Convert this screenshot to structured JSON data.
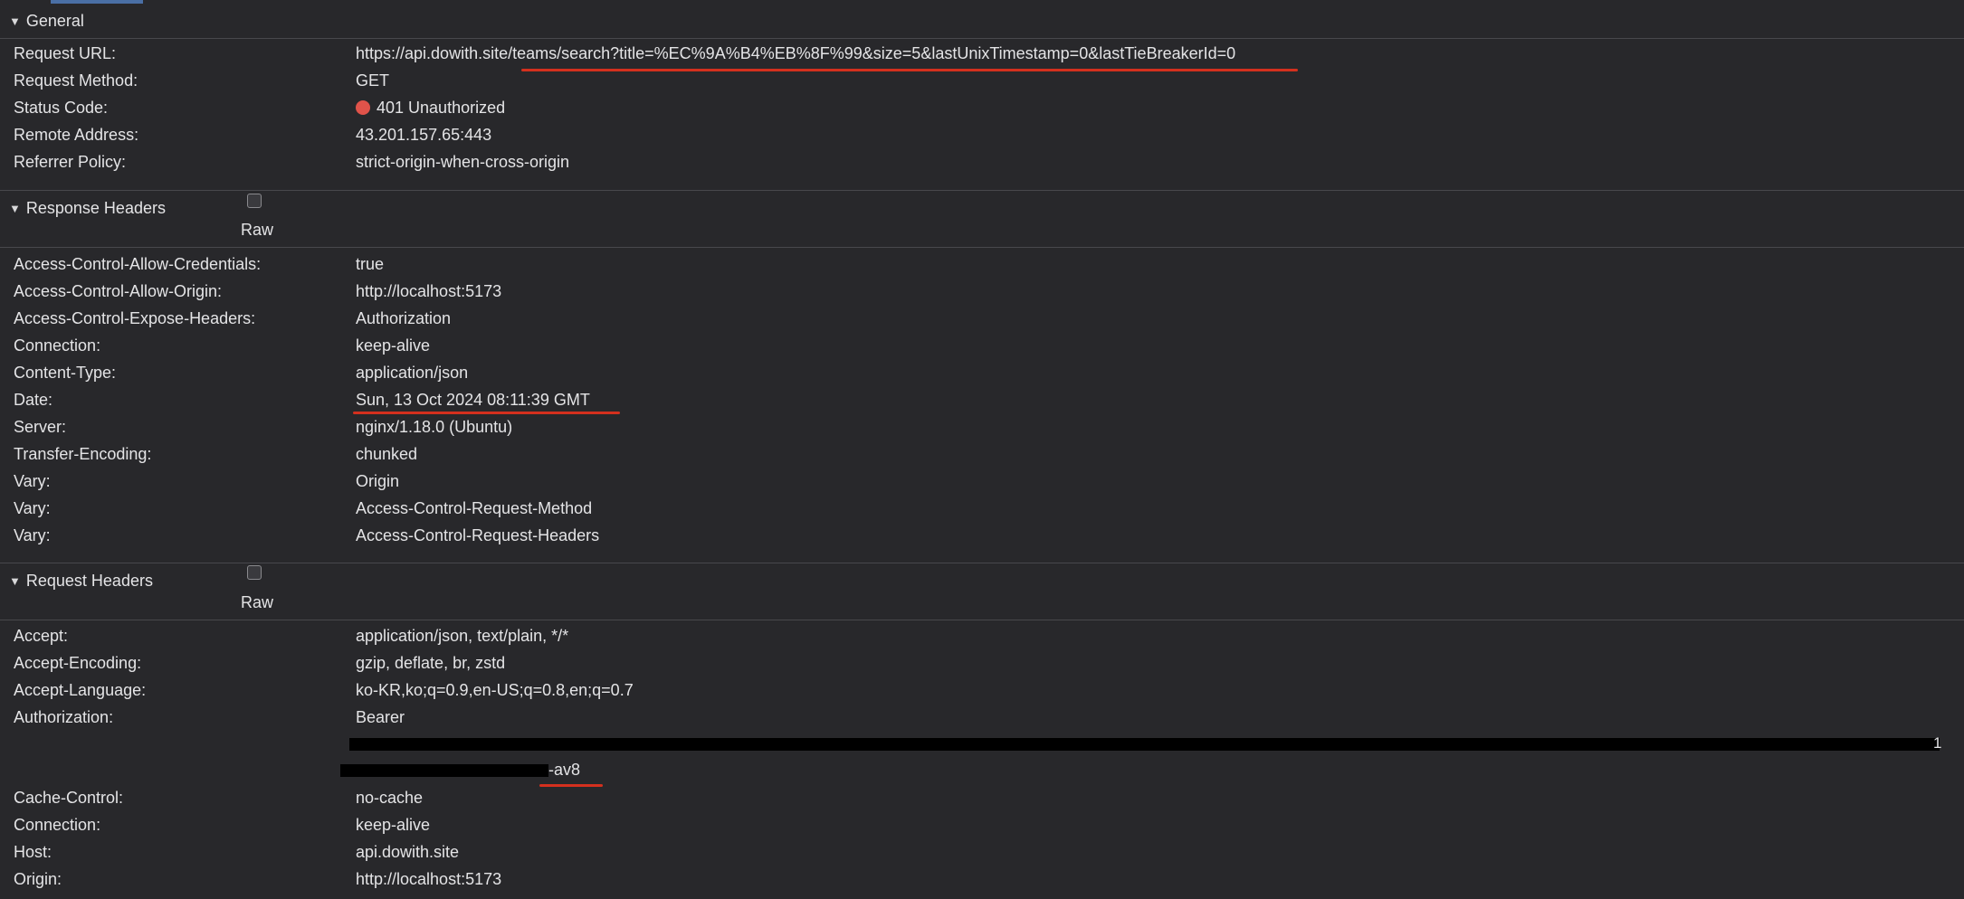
{
  "general": {
    "title": "General",
    "rows": [
      {
        "key": "Request URL:",
        "value": "https://api.dowith.site/teams/search?title=%EC%9A%B4%EB%8F%99&size=5&lastUnixTimestamp=0&lastTieBreakerId=0"
      },
      {
        "key": "Request Method:",
        "value": "GET"
      },
      {
        "key": "Status Code:",
        "value": "401 Unauthorized"
      },
      {
        "key": "Remote Address:",
        "value": "43.201.157.65:443"
      },
      {
        "key": "Referrer Policy:",
        "value": "strict-origin-when-cross-origin"
      }
    ],
    "status_color": "#e0534a"
  },
  "response_headers": {
    "title": "Response Headers",
    "raw_label": "Raw",
    "rows": [
      {
        "key": "Access-Control-Allow-Credentials:",
        "value": "true"
      },
      {
        "key": "Access-Control-Allow-Origin:",
        "value": "http://localhost:5173"
      },
      {
        "key": "Access-Control-Expose-Headers:",
        "value": "Authorization"
      },
      {
        "key": "Connection:",
        "value": "keep-alive"
      },
      {
        "key": "Content-Type:",
        "value": "application/json"
      },
      {
        "key": "Date:",
        "value": "Sun, 13 Oct 2024 08:11:39 GMT"
      },
      {
        "key": "Server:",
        "value": "nginx/1.18.0 (Ubuntu)"
      },
      {
        "key": "Transfer-Encoding:",
        "value": "chunked"
      },
      {
        "key": "Vary:",
        "value": "Origin"
      },
      {
        "key": "Vary:",
        "value": "Access-Control-Request-Method"
      },
      {
        "key": "Vary:",
        "value": "Access-Control-Request-Headers"
      }
    ]
  },
  "request_headers": {
    "title": "Request Headers",
    "raw_label": "Raw",
    "rows": [
      {
        "key": "Accept:",
        "value": "application/json, text/plain, */*"
      },
      {
        "key": "Accept-Encoding:",
        "value": "gzip, deflate, br, zstd"
      },
      {
        "key": "Accept-Language:",
        "value": "ko-KR,ko;q=0.9,en-US;q=0.8,en;q=0.7"
      },
      {
        "key": "Authorization:",
        "value": "Bearer"
      },
      {
        "key": "Cache-Control:",
        "value": "no-cache"
      },
      {
        "key": "Connection:",
        "value": "keep-alive"
      },
      {
        "key": "Host:",
        "value": "api.dowith.site"
      },
      {
        "key": "Origin:",
        "value": "http://localhost:5173"
      }
    ],
    "auth_tail_char": "1",
    "auth_tail_text": "-av8"
  },
  "colors": {
    "background": "#28282b",
    "text": "#e4e4e6",
    "annotation_red": "#d4301e"
  }
}
